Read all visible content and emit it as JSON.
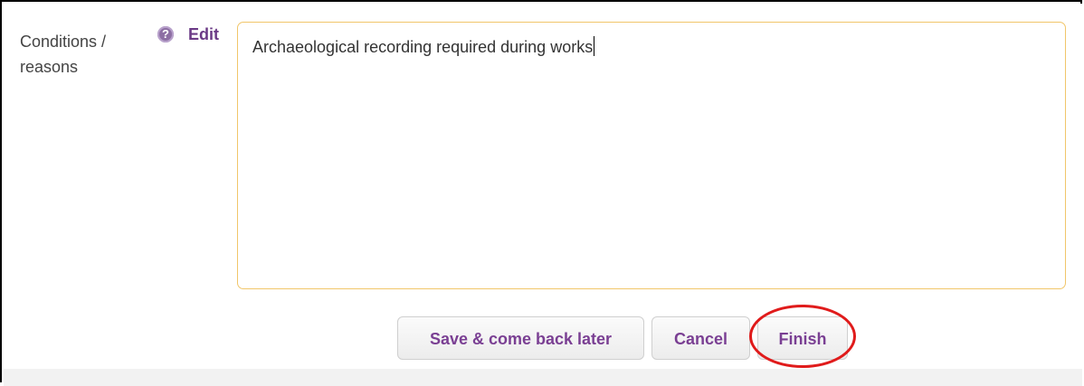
{
  "form": {
    "field_label": "Conditions / reasons",
    "help_icon_glyph": "?",
    "edit_label": "Edit",
    "textarea_value": "Archaeological recording required during works"
  },
  "actions": {
    "save_label": "Save & come back later",
    "cancel_label": "Cancel",
    "finish_label": "Finish"
  },
  "colors": {
    "accent": "#7a3f93",
    "textarea_border": "#f1c66a",
    "highlight_ring": "#e01b1b"
  }
}
